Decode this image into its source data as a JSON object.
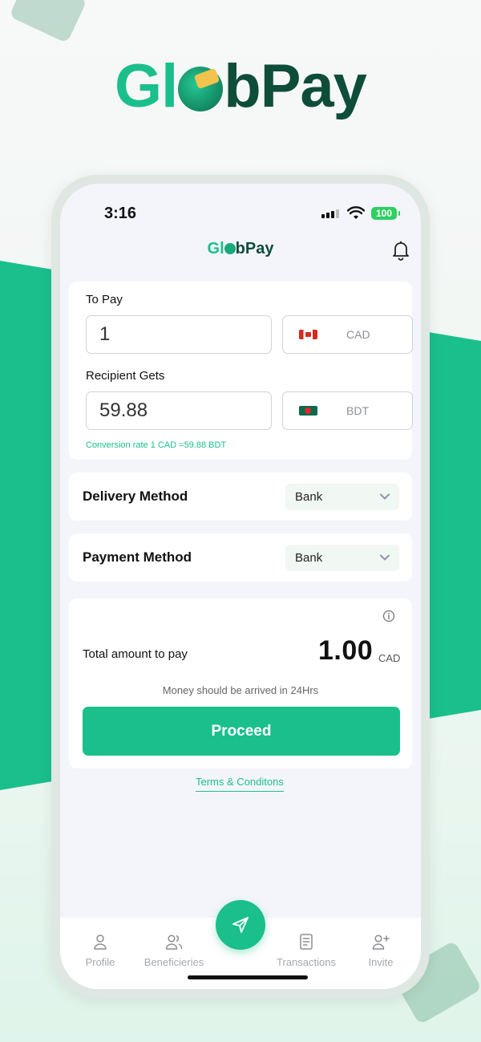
{
  "brand": {
    "logo_left": "Gl",
    "logo_right": "b",
    "logo_pay": "Pay",
    "accent_color": "#1bbf8c",
    "dark_color": "#0e4d3a"
  },
  "status_bar": {
    "time": "3:16",
    "battery": "100"
  },
  "header": {
    "logo_left": "Gl",
    "logo_right": "b",
    "logo_pay": "Pay",
    "notification_icon": "bell-icon"
  },
  "to_pay": {
    "label": "To Pay",
    "amount": "1",
    "currency": "CAD",
    "flag_icon": "canada-flag-icon"
  },
  "recipient": {
    "label": "Recipient Gets",
    "amount": "59.88",
    "currency": "BDT",
    "flag_icon": "bangladesh-flag-icon"
  },
  "conversion_rate": "Conversion rate 1 CAD =59.88  BDT",
  "delivery_method": {
    "label": "Delivery Method",
    "value": "Bank"
  },
  "payment_method": {
    "label": "Payment Method",
    "value": "Bank"
  },
  "total": {
    "label": "Total amount to pay",
    "amount": "1.00",
    "currency": "CAD",
    "note": "Money should be arrived in 24Hrs"
  },
  "proceed_label": "Proceed",
  "terms_label": "Terms & Conditons",
  "nav": {
    "items": [
      {
        "label": "Profile",
        "icon": "person-icon"
      },
      {
        "label": "Beneficieries",
        "icon": "people-icon"
      },
      {
        "label": "Transactions",
        "icon": "document-icon"
      },
      {
        "label": "Invite",
        "icon": "add-person-icon"
      }
    ],
    "fab_icon": "send-icon"
  }
}
